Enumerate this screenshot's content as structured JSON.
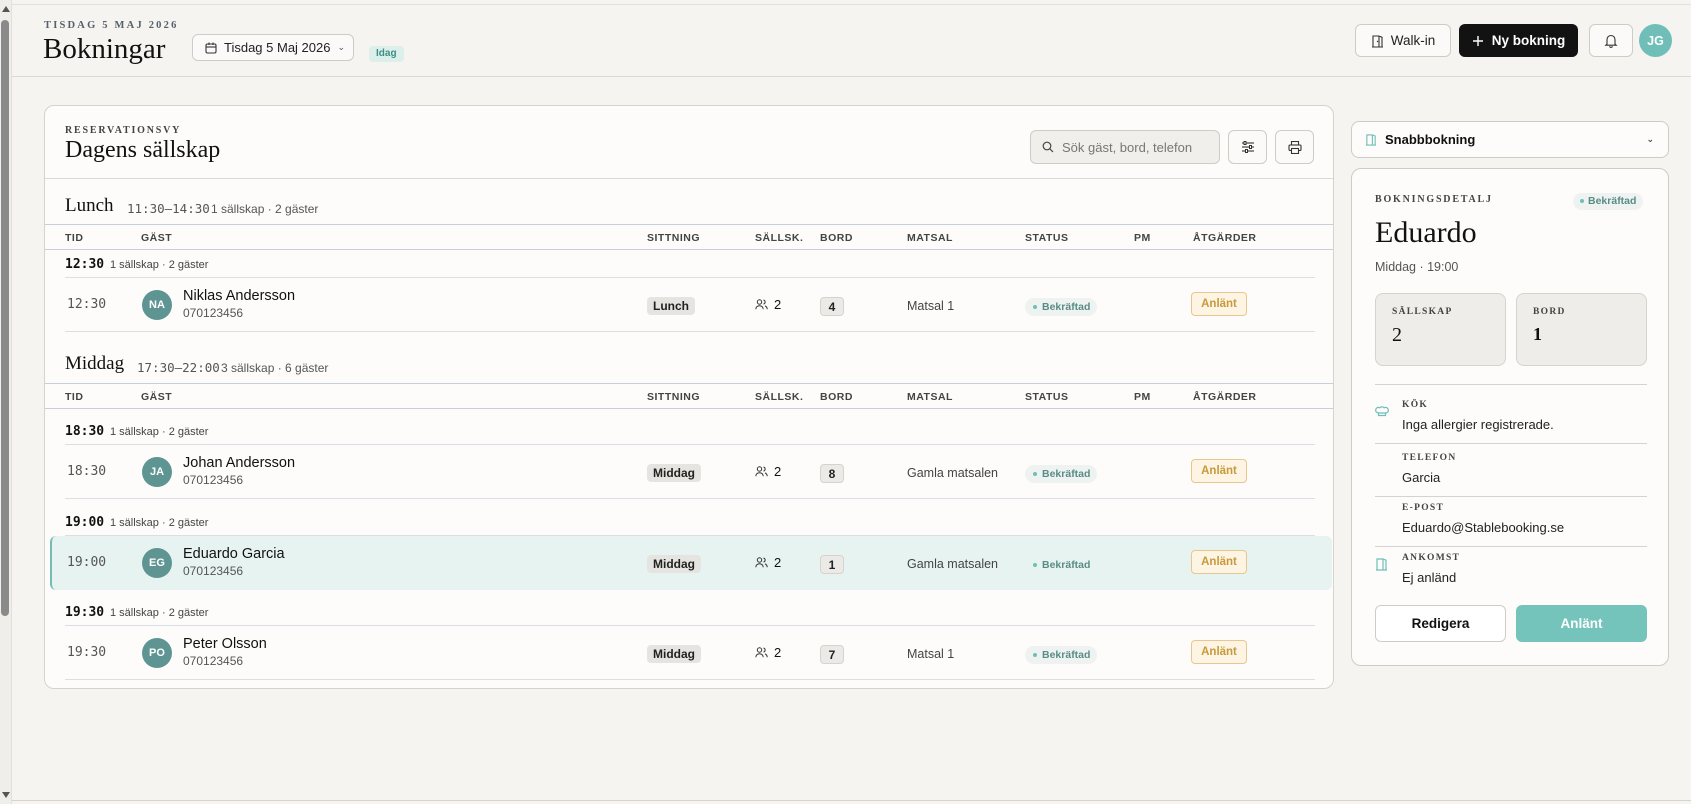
{
  "header": {
    "date_eyebrow": "TISDAG 5 MAJ 2026",
    "title": "Bokningar",
    "date_picker": "Tisdag 5 Maj 2026",
    "today_badge": "Idag",
    "walkin_label": "Walk-in",
    "new_booking_label": "Ny bokning",
    "avatar_initials": "JG"
  },
  "card": {
    "eyebrow": "RESERVATIONSVY",
    "title": "Dagens sällskap",
    "search_placeholder": "Sök gäst, bord, telefon"
  },
  "columns": [
    "TID",
    "GÄST",
    "SITTNING",
    "SÄLLSK.",
    "BORD",
    "MATSAL",
    "STATUS",
    "PM",
    "ÅTGÄRDER"
  ],
  "sections": [
    {
      "title": "Lunch",
      "hours": "11:30–14:30",
      "meta": "1 sällskap · 2 gäster",
      "groups": [
        {
          "time": "12:30",
          "meta": "1 sällskap · 2 gäster",
          "rows": [
            {
              "time": "12:30",
              "initials": "NA",
              "name": "Niklas Andersson",
              "phone": "070123456",
              "sitting": "Lunch",
              "party": "2",
              "table": "4",
              "room": "Matsal 1",
              "status": "Bekräftad",
              "action": "Anlänt"
            }
          ]
        }
      ]
    },
    {
      "title": "Middag",
      "hours": "17:30–22:00",
      "meta": "3 sällskap · 6 gäster",
      "groups": [
        {
          "time": "18:30",
          "meta": "1 sällskap · 2 gäster",
          "rows": [
            {
              "time": "18:30",
              "initials": "JA",
              "name": "Johan Andersson",
              "phone": "070123456",
              "sitting": "Middag",
              "party": "2",
              "table": "8",
              "room": "Gamla matsalen",
              "status": "Bekräftad",
              "action": "Anlänt"
            }
          ]
        },
        {
          "time": "19:00",
          "meta": "1 sällskap · 2 gäster",
          "rows": [
            {
              "time": "19:00",
              "initials": "EG",
              "name": "Eduardo Garcia",
              "phone": "070123456",
              "sitting": "Middag",
              "party": "2",
              "table": "1",
              "room": "Gamla matsalen",
              "status": "Bekräftad",
              "action": "Anlänt"
            }
          ]
        },
        {
          "time": "19:30",
          "meta": "1 sällskap · 2 gäster",
          "rows": [
            {
              "time": "19:30",
              "initials": "PO",
              "name": "Peter Olsson",
              "phone": "070123456",
              "sitting": "Middag",
              "party": "2",
              "table": "7",
              "room": "Matsal 1",
              "status": "Bekräftad",
              "action": "Anlänt"
            }
          ]
        }
      ]
    }
  ],
  "quick_booking": {
    "label": "Snabbbokning"
  },
  "detail": {
    "eyebrow": "BOKNINGSDETALJ",
    "status": "Bekräftad",
    "name": "Eduardo",
    "subtitle": "Middag · 19:00",
    "party_label": "SÄLLSKAP",
    "party_value": "2",
    "table_label": "BORD",
    "table_value": "1",
    "kitchen_label": "KÖK",
    "kitchen_value": "Inga allergier registrerade.",
    "phone_label": "TELEFON",
    "phone_value": "Garcia",
    "email_label": "E-POST",
    "email_value": "Eduardo@Stablebooking.se",
    "arrival_label": "ANKOMST",
    "arrival_value": "Ej anländ",
    "edit_label": "Redigera",
    "arrived_label": "Anlänt"
  },
  "colors": {
    "accent_teal": "#75c4bc",
    "primary_dark": "#121212",
    "action_amber": "#c79a3a",
    "selected_row": "#e7f3f1"
  },
  "icons": [
    "calendar-icon",
    "door-icon",
    "plus-icon",
    "bell-icon",
    "search-icon",
    "sliders-icon",
    "printer-icon",
    "users-icon",
    "chef-hat-icon",
    "chevron-down-icon"
  ]
}
